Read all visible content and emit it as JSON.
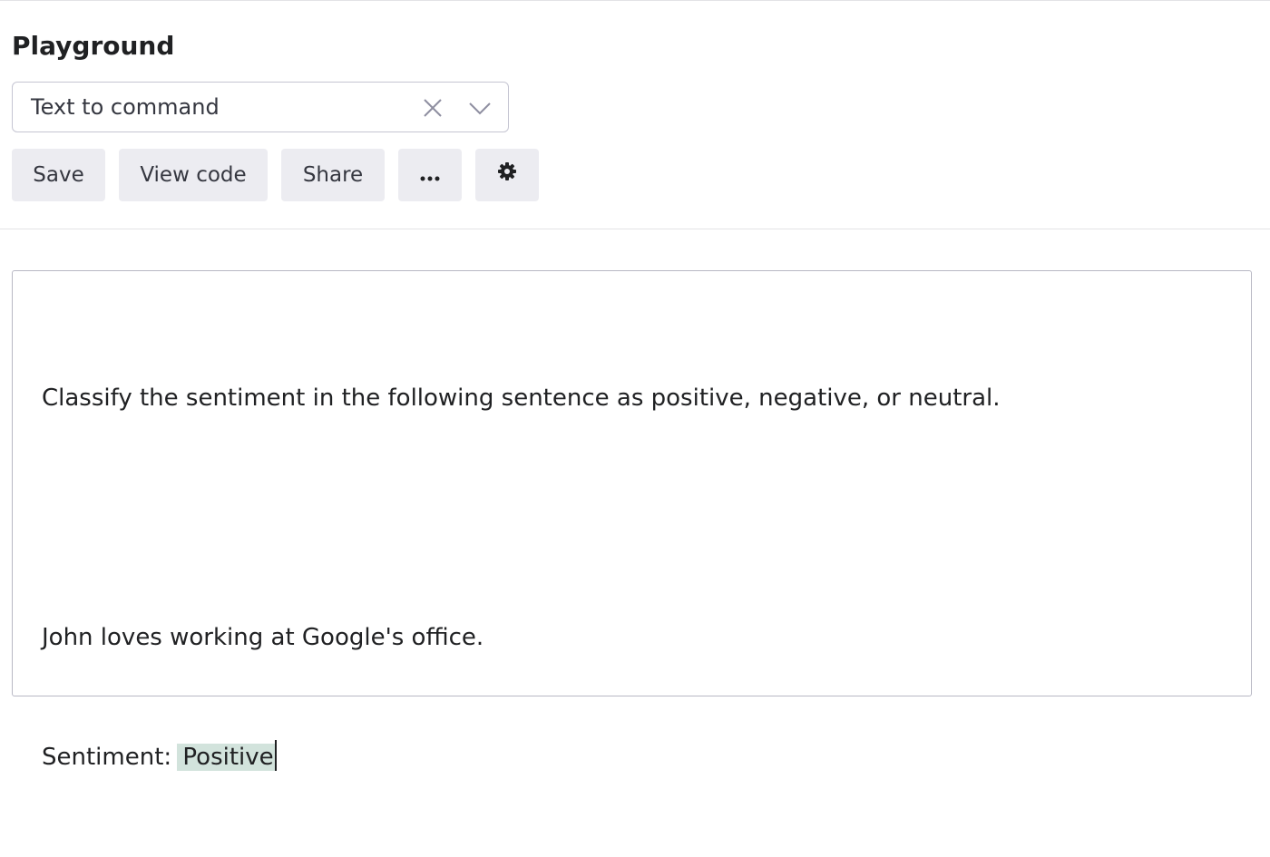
{
  "header": {
    "title": "Playground"
  },
  "preset": {
    "selected": "Text to command",
    "clear_icon": "close-icon",
    "dropdown_icon": "chevron-down-icon"
  },
  "toolbar": {
    "save_label": "Save",
    "view_code_label": "View code",
    "share_label": "Share",
    "more_icon": "more-horizontal-icon",
    "settings_icon": "gear-icon"
  },
  "editor": {
    "prompt_line_1": "Classify the sentiment in the following sentence as positive, negative, or neutral.",
    "prompt_line_2": "",
    "prompt_line_3": "John loves working at Google's office.",
    "prompt_line_4_prefix": "Sentiment:",
    "completion": "Positive",
    "completion_highlight_color": "#d2e3dc"
  },
  "colors": {
    "button_bg": "#ececf1",
    "border": "#c5c5d2",
    "text": "#202123"
  }
}
